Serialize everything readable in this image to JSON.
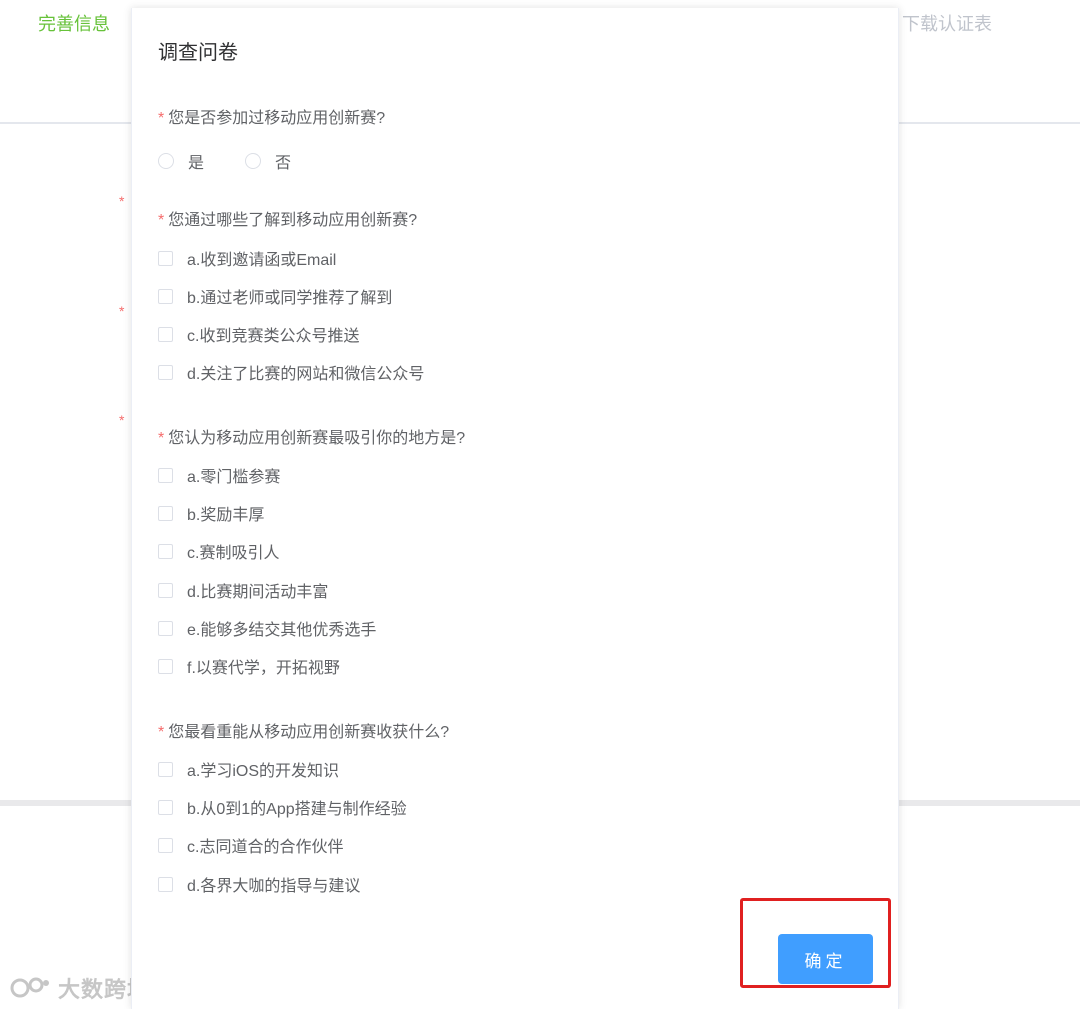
{
  "background": {
    "step_left": "完善信息",
    "step_right": "下载认证表",
    "required_star": "*"
  },
  "watermark": {
    "text": "大数跨境"
  },
  "modal": {
    "title": "调查问卷",
    "required_star": "*",
    "questions": [
      {
        "label": "您是否参加过移动应用创新赛?",
        "type": "radio",
        "options": [
          "是",
          "否"
        ]
      },
      {
        "label": "您通过哪些了解到移动应用创新赛?",
        "type": "checkbox",
        "options": [
          "a.收到邀请函或Email",
          "b.通过老师或同学推荐了解到",
          "c.收到竞赛类公众号推送",
          "d.关注了比赛的网站和微信公众号"
        ]
      },
      {
        "label": "您认为移动应用创新赛最吸引你的地方是?",
        "type": "checkbox",
        "options": [
          "a.零门槛参赛",
          "b.奖励丰厚",
          "c.赛制吸引人",
          "d.比赛期间活动丰富",
          "e.能够多结交其他优秀选手",
          "f.以赛代学，开拓视野"
        ]
      },
      {
        "label": "您最看重能从移动应用创新赛收获什么?",
        "type": "checkbox",
        "options": [
          "a.学习iOS的开发知识",
          "b.从0到1的App搭建与制作经验",
          "c.志同道合的合作伙伴",
          "d.各界大咖的指导与建议"
        ]
      }
    ],
    "confirm_label": "确定"
  },
  "colors": {
    "primary": "#409eff",
    "required": "#f56c6c",
    "step_active": "#67c23a",
    "highlight": "#e02020"
  }
}
